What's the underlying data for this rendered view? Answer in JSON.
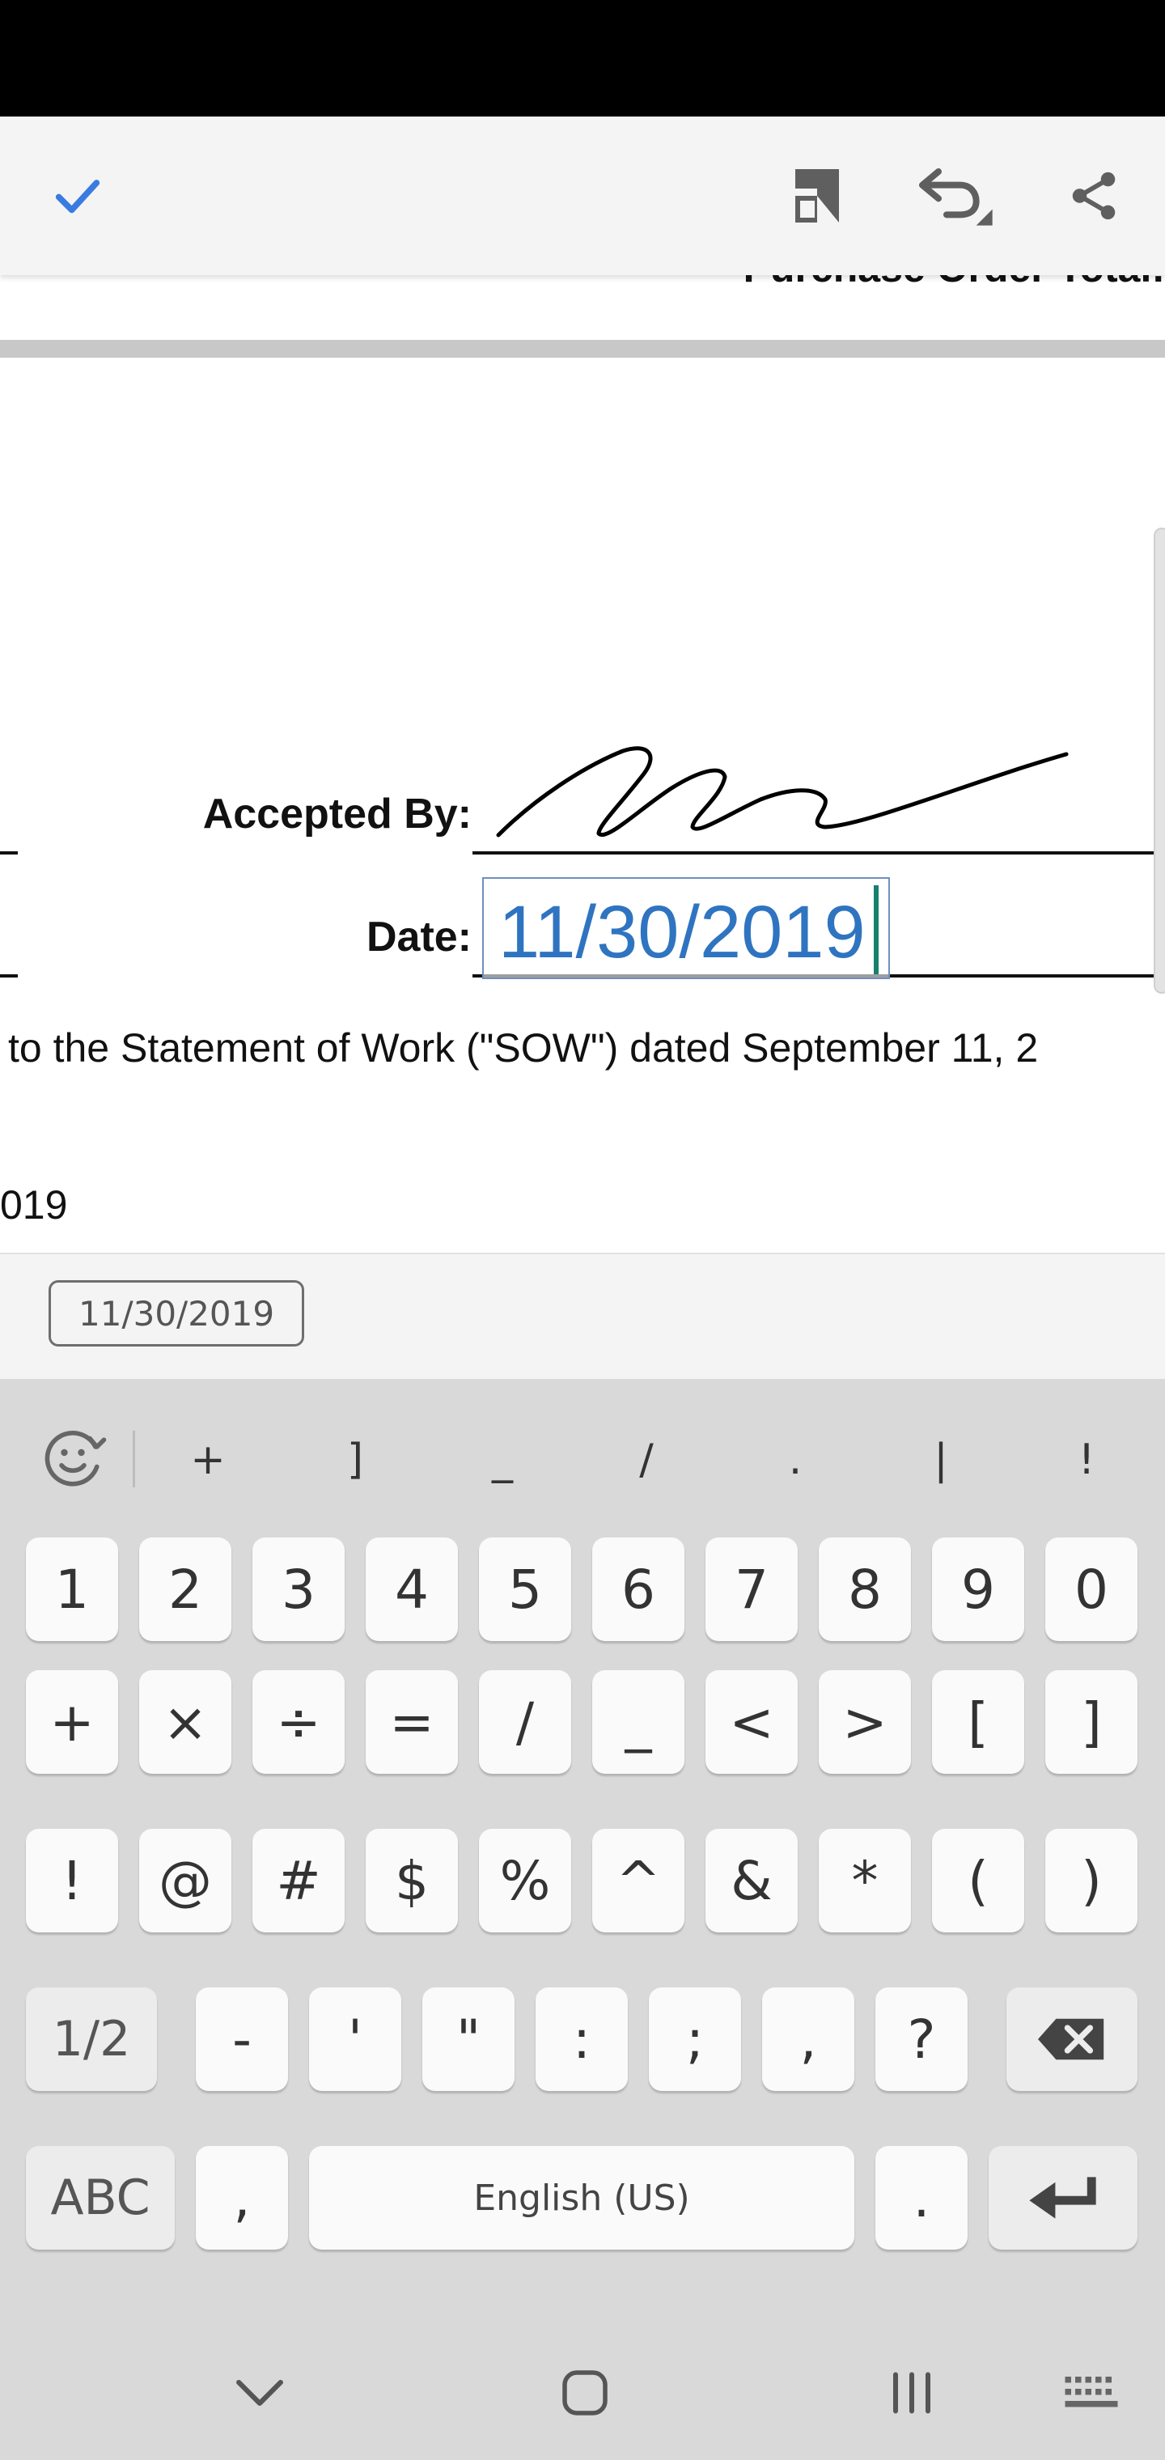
{
  "toolbar": {
    "done_icon": "check-icon",
    "page_icon": "page-layout-icon",
    "undo_icon": "undo-icon",
    "share_icon": "share-icon",
    "accent": "#3a7be0"
  },
  "document": {
    "previous_page_text": "Purchase Order Total:",
    "accepted_label": "Accepted By:",
    "date_label": "Date:",
    "date_value": "11/30/2019",
    "body_line_1": "to the Statement of Work (\"SOW\") dated September 11, 2",
    "body_line_2": "019",
    "signature": "handwritten-signature",
    "date_color": "#2f74c0"
  },
  "suggestion": {
    "chip": "11/30/2019"
  },
  "keyboard": {
    "symbol_strip": [
      "+",
      "]",
      "_",
      "/",
      ".",
      "|",
      "!"
    ],
    "row1": [
      "1",
      "2",
      "3",
      "4",
      "5",
      "6",
      "7",
      "8",
      "9",
      "0"
    ],
    "row2": [
      "+",
      "×",
      "÷",
      "=",
      "/",
      "_",
      "<",
      ">",
      "[",
      "]"
    ],
    "row3": [
      "!",
      "@",
      "#",
      "$",
      "%",
      "^",
      "&",
      "*",
      "(",
      ")"
    ],
    "row4": [
      "-",
      "'",
      "\"",
      ":",
      ";",
      ",",
      "?"
    ],
    "page_toggle": "1/2",
    "abc": "ABC",
    "comma": ",",
    "space": "English (US)",
    "period": ".",
    "backspace_icon": "backspace-icon",
    "enter_icon": "enter-icon",
    "emoji_icon": "emoji-icon"
  },
  "navbar": {
    "back": "chevron-down-icon",
    "home": "home-icon",
    "recents": "recents-icon",
    "keyboard": "keyboard-icon"
  }
}
